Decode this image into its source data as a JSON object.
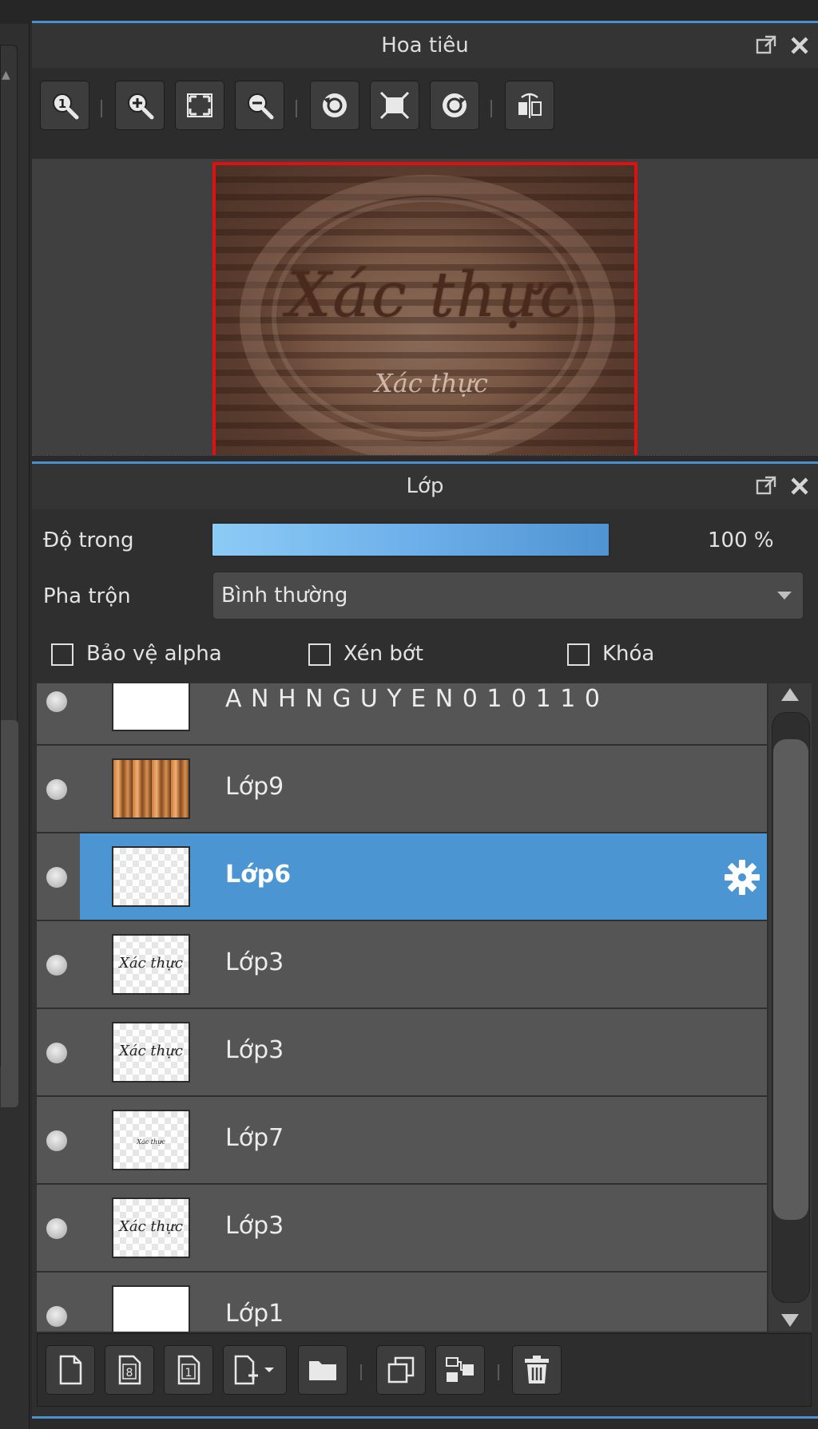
{
  "navigator": {
    "title": "Hoa tiêu",
    "preview": {
      "main_text": "Xác thực",
      "sub_text": "Xác thực"
    }
  },
  "layers_panel": {
    "title": "Lớp",
    "opacity": {
      "label": "Độ trong",
      "value": "100 %",
      "percent": 100
    },
    "blend": {
      "label": "Pha trộn",
      "selected": "Bình thường"
    },
    "checkboxes": [
      {
        "label": "Bảo vệ alpha",
        "checked": false
      },
      {
        "label": "Xén bớt",
        "checked": false
      },
      {
        "label": "Khóa",
        "checked": false
      }
    ],
    "layers": [
      {
        "name": "A N H N G U Y E N 0 1 0 1 1 0",
        "thumb": "blank",
        "selected": false
      },
      {
        "name": "Lớp9",
        "thumb": "copper",
        "selected": false
      },
      {
        "name": "Lớp6",
        "thumb": "transparent",
        "selected": true
      },
      {
        "name": "Lớp3",
        "thumb": "text",
        "thumb_text": "Xác thực",
        "selected": false
      },
      {
        "name": "Lớp3",
        "thumb": "text",
        "thumb_text": "Xác thực",
        "selected": false
      },
      {
        "name": "Lớp7",
        "thumb": "text-small",
        "thumb_text": "Xác thực",
        "selected": false
      },
      {
        "name": "Lớp3",
        "thumb": "text",
        "thumb_text": "Xác thực",
        "selected": false
      },
      {
        "name": "Lớp1",
        "thumb": "blank",
        "selected": false
      }
    ]
  },
  "colors": {
    "accent": "#4a8fd0",
    "selected_row": "#4c95d3",
    "preview_border": "#e01010"
  }
}
